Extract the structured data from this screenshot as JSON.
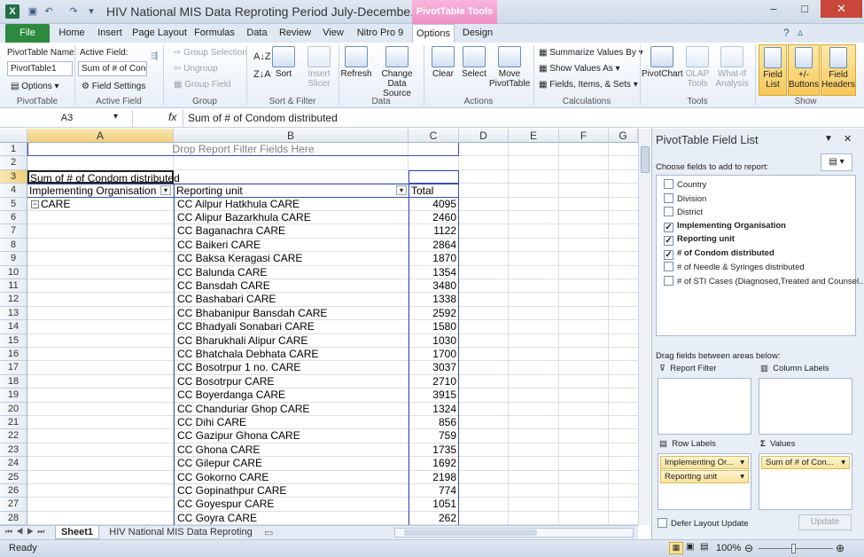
{
  "window": {
    "title": "HIV National MIS Data Reproting Period July-Decembe...",
    "contextual_tab": "PivotTable Tools",
    "controls": {
      "minimize": "–",
      "maximize": "□",
      "close": "✕"
    }
  },
  "ribbon_tabs": [
    "File",
    "Home",
    "Insert",
    "Page Layout",
    "Formulas",
    "Data",
    "Review",
    "View",
    "Nitro Pro 9",
    "Options",
    "Design"
  ],
  "ribbon": {
    "pivottable": {
      "name_label": "PivotTable Name:",
      "name_value": "PivotTable1",
      "options_label": "Options",
      "group_label": "PivotTable"
    },
    "active_field": {
      "label": "Active Field:",
      "value": "Sum of # of Cond",
      "settings_label": "Field Settings",
      "group_label": "Active Field"
    },
    "group": {
      "selection": "Group Selection",
      "ungroup": "Ungroup",
      "field": "Group Field",
      "group_label": "Group"
    },
    "sort_filter": {
      "sort": "Sort",
      "insert_slicer_1": "Insert",
      "insert_slicer_2": "Slicer",
      "group_label": "Sort & Filter"
    },
    "data": {
      "refresh": "Refresh",
      "change_source_1": "Change Data",
      "change_source_2": "Source",
      "group_label": "Data"
    },
    "actions": {
      "clear": "Clear",
      "select": "Select",
      "move_1": "Move",
      "move_2": "PivotTable",
      "group_label": "Actions"
    },
    "calculations": {
      "summarize": "Summarize Values By",
      "show_values": "Show Values As",
      "fields_items": "Fields, Items, & Sets",
      "group_label": "Calculations"
    },
    "tools": {
      "pivotchart": "PivotChart",
      "olap_1": "OLAP",
      "olap_2": "Tools",
      "whatif_1": "What-If",
      "whatif_2": "Analysis",
      "group_label": "Tools"
    },
    "show": {
      "field_list_1": "Field",
      "field_list_2": "List",
      "buttons_1": "+/-",
      "buttons_2": "Buttons",
      "headers_1": "Field",
      "headers_2": "Headers",
      "group_label": "Show"
    }
  },
  "formula_bar": {
    "name_box": "A3",
    "fx": "fx",
    "formula": "Sum of # of Condom distributed"
  },
  "columns": [
    "A",
    "B",
    "C",
    "D",
    "E",
    "F",
    "G"
  ],
  "rows": [
    "1",
    "2",
    "3",
    "4",
    "5",
    "6",
    "7",
    "8",
    "9",
    "10",
    "11",
    "12",
    "13",
    "14",
    "15",
    "16",
    "17",
    "18",
    "19",
    "20",
    "21",
    "22",
    "23",
    "24",
    "25",
    "26",
    "27",
    "28"
  ],
  "pivot": {
    "drop_filter_text": "Drop Report Filter Fields Here",
    "value_header": "Sum of # of Condom distributed",
    "col_header_total": "Total",
    "row_header_1": "Implementing Organisation",
    "row_header_2": "Reporting unit",
    "org": "CARE",
    "units": [
      "CC Ailpur Hatkhula CARE",
      "CC Alipur Bazarkhula CARE",
      "CC Baganachra CARE",
      "CC Baikeri CARE",
      "CC Baksa Keragasi CARE",
      "CC Balunda CARE",
      "CC Bansdah CARE",
      "CC Bashabari CARE",
      "CC Bhabanipur Bansdah CARE",
      "CC Bhadyali Sonabari CARE",
      "CC Bharukhali Alipur CARE",
      "CC Bhatchala Debhata CARE",
      "CC Bosotrpur 1 no. CARE",
      "CC Bosotrpur CARE",
      "CC Boyerdanga CARE",
      "CC Chanduriar Ghop CARE",
      "CC Dihi CARE",
      "CC Gazipur Ghona CARE",
      "CC Ghona CARE",
      "CC Gilepur CARE",
      "CC Gokorno CARE",
      "CC Gopinathpur CARE",
      "CC Goyespur CARE",
      "CC Goyra CARE"
    ],
    "totals": [
      "4095",
      "2460",
      "1122",
      "2864",
      "1870",
      "1354",
      "3480",
      "1338",
      "2592",
      "1580",
      "1030",
      "1700",
      "3037",
      "2710",
      "3915",
      "1324",
      "856",
      "759",
      "1735",
      "1692",
      "2198",
      "774",
      "1051",
      "262"
    ]
  },
  "sheet_tabs": [
    "Sheet1",
    "HIV National MIS Data Reproting"
  ],
  "status": {
    "ready": "Ready",
    "zoom": "100%"
  },
  "field_list": {
    "title": "PivotTable Field List",
    "choose_label": "Choose fields to add to report:",
    "fields": [
      {
        "name": "Country",
        "checked": false
      },
      {
        "name": "Division",
        "checked": false
      },
      {
        "name": "District",
        "checked": false
      },
      {
        "name": "Implementing Organisation",
        "checked": true
      },
      {
        "name": "Reporting unit",
        "checked": true
      },
      {
        "name": "# of Condom distributed",
        "checked": true
      },
      {
        "name": "# of Needle & Syringes distributed",
        "checked": false
      },
      {
        "name": "# of STI Cases (Diagnosed,Treated and Counsel...",
        "checked": false
      }
    ],
    "drag_label": "Drag fields between areas below:",
    "report_filter": "Report Filter",
    "column_labels": "Column Labels",
    "row_labels": "Row Labels",
    "values": "Values",
    "row_chips": [
      "Implementing Or...",
      "Reporting unit"
    ],
    "value_chips": [
      "Sum of # of Con..."
    ],
    "defer_label": "Defer Layout Update",
    "update_label": "Update"
  }
}
